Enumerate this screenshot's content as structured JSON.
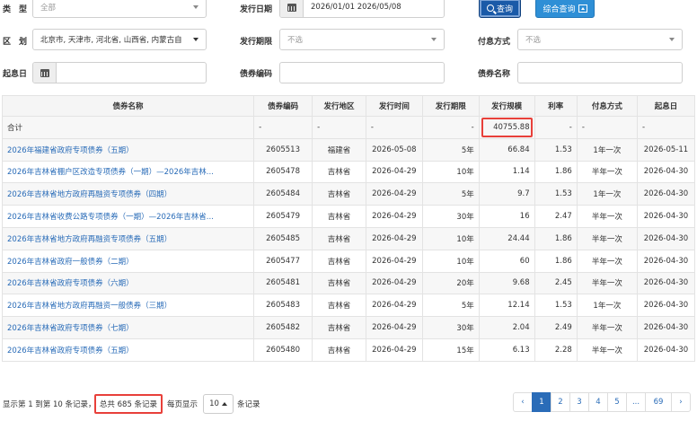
{
  "filters": {
    "type_label": "类　型",
    "type_value": "全部",
    "region_label": "区　划",
    "region_value": "北京市, 天津市, 河北省, 山西省, 内蒙古自",
    "start_interest_label": "起息日",
    "issue_date_label": "发行日期",
    "issue_date_value": "2026/01/01 2026/05/08",
    "issue_term_label": "发行期限",
    "issue_term_value": "不选",
    "bond_code_label": "债券编码",
    "interest_method_label": "付息方式",
    "interest_method_value": "不选",
    "bond_name_label": "债券名称",
    "query_button": "查询",
    "combo_query_button": "综合查询"
  },
  "table": {
    "columns": [
      "债券名称",
      "债券编码",
      "发行地区",
      "发行时间",
      "发行期限",
      "发行规模",
      "利率",
      "付息方式",
      "起息日"
    ],
    "total_row": [
      "合计",
      "-",
      "-",
      "-",
      "-",
      "40755.88",
      "-",
      "-",
      "-"
    ],
    "rows": [
      [
        "2026年福建省政府专项债券（五期）",
        "2605513",
        "福建省",
        "2026-05-08",
        "5年",
        "66.84",
        "1.53",
        "1年一次",
        "2026-05-11"
      ],
      [
        "2026年吉林省棚户区改造专项债券（一期）—2026年吉林...",
        "2605478",
        "吉林省",
        "2026-04-29",
        "10年",
        "1.14",
        "1.86",
        "半年一次",
        "2026-04-30"
      ],
      [
        "2026年吉林省地方政府再融资专项债券（四期）",
        "2605484",
        "吉林省",
        "2026-04-29",
        "5年",
        "9.7",
        "1.53",
        "1年一次",
        "2026-04-30"
      ],
      [
        "2026年吉林省收费公路专项债券（一期）—2026年吉林省...",
        "2605479",
        "吉林省",
        "2026-04-29",
        "30年",
        "16",
        "2.47",
        "半年一次",
        "2026-04-30"
      ],
      [
        "2026年吉林省地方政府再融资专项债券（五期）",
        "2605485",
        "吉林省",
        "2026-04-29",
        "10年",
        "24.44",
        "1.86",
        "半年一次",
        "2026-04-30"
      ],
      [
        "2026年吉林省政府一般债券（二期）",
        "2605477",
        "吉林省",
        "2026-04-29",
        "10年",
        "60",
        "1.86",
        "半年一次",
        "2026-04-30"
      ],
      [
        "2026年吉林省政府专项债券（六期）",
        "2605481",
        "吉林省",
        "2026-04-29",
        "20年",
        "9.68",
        "2.45",
        "半年一次",
        "2026-04-30"
      ],
      [
        "2026年吉林省地方政府再融资一般债券（三期）",
        "2605483",
        "吉林省",
        "2026-04-29",
        "5年",
        "12.14",
        "1.53",
        "1年一次",
        "2026-04-30"
      ],
      [
        "2026年吉林省政府专项债券（七期）",
        "2605482",
        "吉林省",
        "2026-04-29",
        "30年",
        "2.04",
        "2.49",
        "半年一次",
        "2026-04-30"
      ],
      [
        "2026年吉林省政府专项债券（五期）",
        "2605480",
        "吉林省",
        "2026-04-29",
        "15年",
        "6.13",
        "2.28",
        "半年一次",
        "2026-04-30"
      ]
    ]
  },
  "footer": {
    "showing": "显示第 1 到第 10 条记录，",
    "total": "总共 685 条记录",
    "per_page_label": "每页显示",
    "per_page_value": "10",
    "records_suffix": "条记录",
    "pages": [
      "‹",
      "1",
      "2",
      "3",
      "4",
      "5",
      "...",
      "69",
      "›"
    ],
    "active_page": "1"
  },
  "colors": {
    "primary": "#2a6cb8",
    "highlight": "#e8403a"
  }
}
